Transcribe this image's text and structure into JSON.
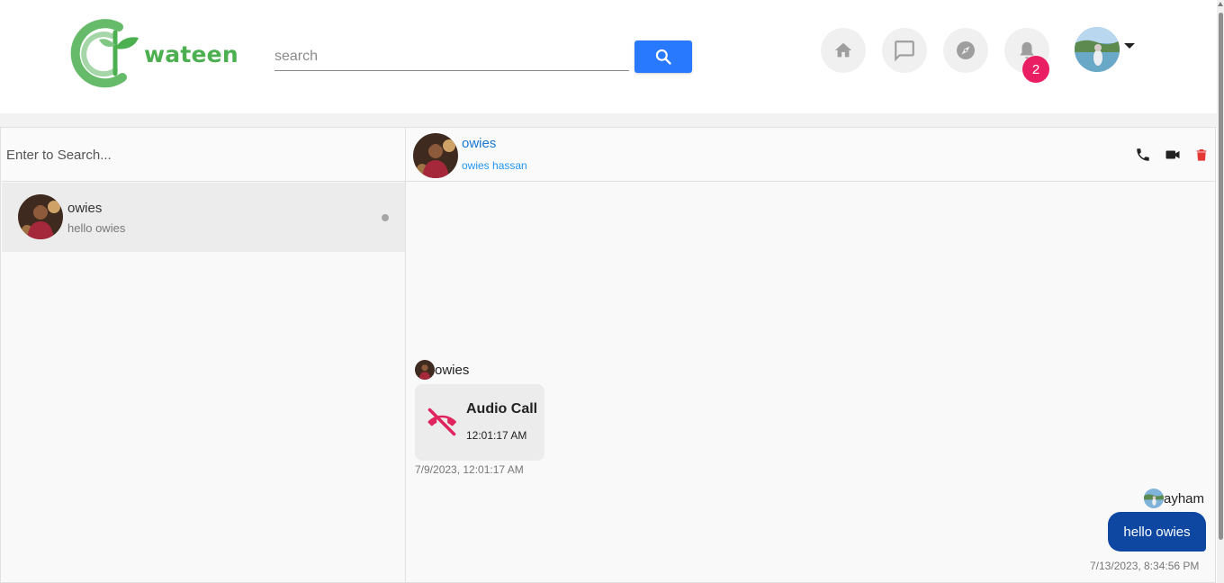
{
  "brand": {
    "name": "wateen",
    "color": "#4caf50"
  },
  "header": {
    "search_placeholder": "search",
    "search_button_icon": "search-icon",
    "nav": [
      {
        "icon": "home-icon"
      },
      {
        "icon": "chat-icon"
      },
      {
        "icon": "explore-icon"
      },
      {
        "icon": "bell-icon"
      }
    ],
    "notification_count": "2",
    "profile_menu_icon": "caret-down-icon"
  },
  "sidebar": {
    "search_placeholder": "Enter to Search...",
    "conversations": [
      {
        "name": "owies",
        "last_message": "hello owies",
        "status": "dot"
      }
    ]
  },
  "chat": {
    "contact_name": "owies",
    "contact_fullname": "owies hassan",
    "actions": [
      "phone-icon",
      "video-icon",
      "trash-icon"
    ],
    "messages": [
      {
        "sender": "owies",
        "type": "call",
        "call_label": "Audio Call",
        "call_time": "12:01:17 AM",
        "timestamp": "7/9/2023, 12:01:17 AM"
      },
      {
        "sender": "ayham",
        "type": "text",
        "text": "hello owies",
        "timestamp": "7/13/2023, 8:34:56 PM"
      }
    ]
  },
  "colors": {
    "accent": "#2979ff",
    "badge": "#e91e63",
    "outgoing_bubble": "#0d47a1",
    "missed_call": "#e0245e",
    "delete": "#e53935"
  }
}
